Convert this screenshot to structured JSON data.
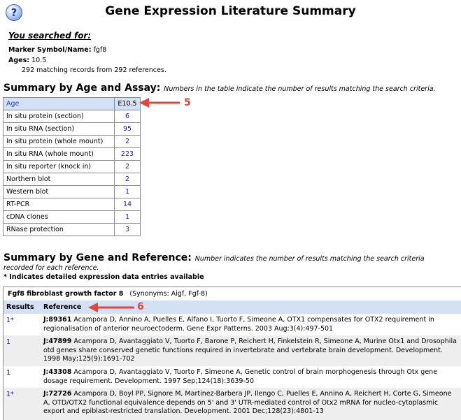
{
  "header": {
    "help_glyph": "?",
    "title": "Gene Expression Literature Summary"
  },
  "search": {
    "label": "You searched for:",
    "marker_label": "Marker Symbol/Name:",
    "marker_value": "fgf8",
    "ages_label": "Ages:",
    "ages_value": "10.5",
    "match_text": "292 matching records from 292 references."
  },
  "age_assay": {
    "heading": "Summary by Age and Assay:",
    "note": "Numbers in the table indicate the number of results matching the search criteria.",
    "col_label": "Age",
    "col_age": "E10.5",
    "rows": [
      {
        "assay": "In situ protein (section)",
        "count": "6"
      },
      {
        "assay": "In situ RNA (section)",
        "count": "95"
      },
      {
        "assay": "In situ protein (whole mount)",
        "count": "2"
      },
      {
        "assay": "In situ RNA (whole mount)",
        "count": "223"
      },
      {
        "assay": "In situ reporter (knock in)",
        "count": "2"
      },
      {
        "assay": "Northern blot",
        "count": "2"
      },
      {
        "assay": "Western blot",
        "count": "1"
      },
      {
        "assay": "RT-PCR",
        "count": "14"
      },
      {
        "assay": "cDNA clones",
        "count": "1"
      },
      {
        "assay": "RNase protection",
        "count": "3"
      }
    ]
  },
  "annotations": {
    "arrow5": "5",
    "arrow6": "6",
    "arrow_color": "#e1463c"
  },
  "gene_ref": {
    "heading": "Summary by Gene and Reference:",
    "note_line1": "Number indicates the number of results matching the search criteria",
    "note_line2": "recorded for each reference.",
    "star_note": "* Indicates detailed expression data entries available",
    "gene_symbol": "Fgf8",
    "gene_name": "fibroblast growth factor 8",
    "synonyms": "(Synonyms: Aigf, Fgf-8)",
    "col_results": "Results",
    "col_reference": "Reference",
    "refs": [
      {
        "count": "1*",
        "jnum": "J:89361",
        "text": "Acampora D, Annino A, Puelles E, Alfano I, Tuorto F, Simeone A, OTX1 compensates for OTX2 requirement in regionalisation of anterior neuroectoderm. Gene Expr Patterns. 2003 Aug;3(4):497-501"
      },
      {
        "count": "1",
        "jnum": "J:47899",
        "text": "Acampora D, Avantaggiato V, Tuorto F, Barone P, Reichert H, Finkelstein R, Simeone A, Murine Otx1 and Drosophila otd genes share conserved genetic functions required in invertebrate and vertebrate brain development. Development. 1998 May;125(9):1691-702"
      },
      {
        "count": "1",
        "jnum": "J:43308",
        "text": "Acampora D, Avantaggiato V, Tuorto F, Simeone A, Genetic control of brain morphogenesis through Otx gene dosage requirement. Development. 1997 Sep;124(18):3639-50"
      },
      {
        "count": "1*",
        "jnum": "J:72726",
        "text": "Acampora D, Boyl PP, Signore M, Martinez-Barbera JP, Ilengo C, Puelles E, Annino A, Reichert H, Corte G, Simeone A, OTD/OTX2 functional equivalence depends on 5' and 3' UTR-mediated control of Otx2 mRNA for nucleo-cytoplasmic export and epiblast-restricted translation. Development. 2001 Dec;128(23):4801-13"
      }
    ]
  }
}
